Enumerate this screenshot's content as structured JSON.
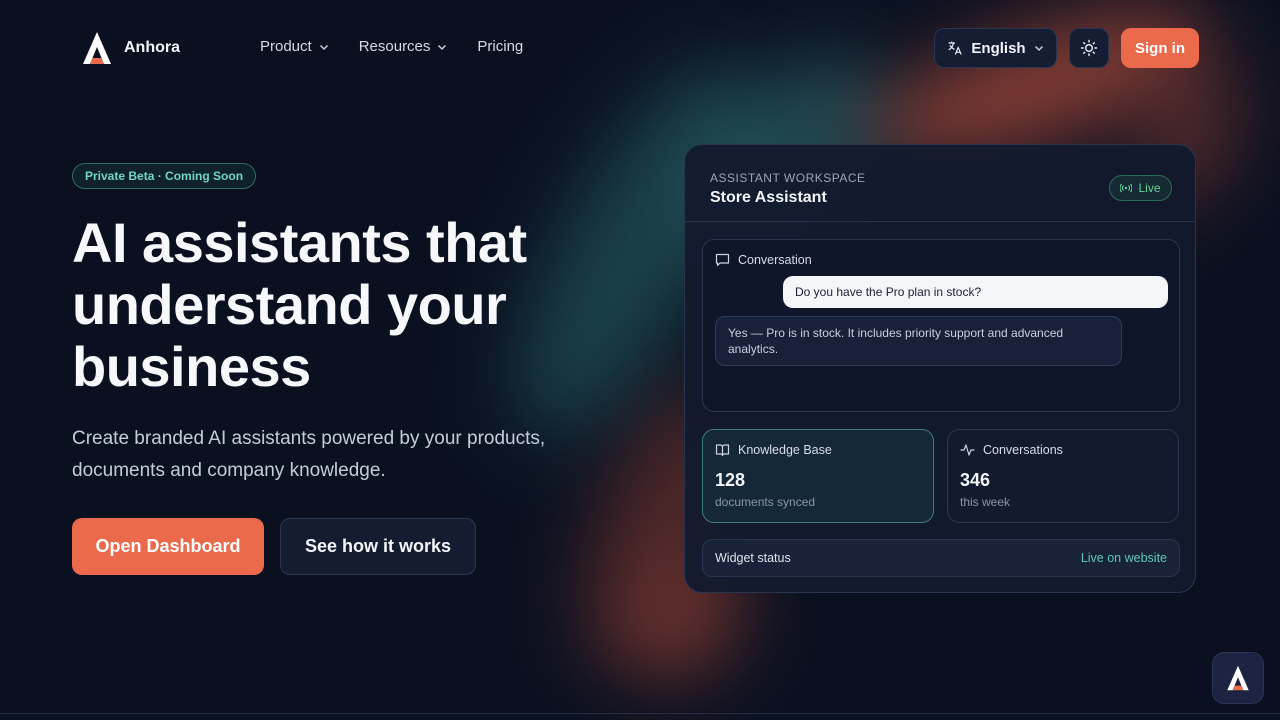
{
  "brand": {
    "name": "Anhora"
  },
  "nav": {
    "links": [
      {
        "label": "Product",
        "has_dropdown": true
      },
      {
        "label": "Resources",
        "has_dropdown": true
      },
      {
        "label": "Pricing",
        "has_dropdown": false
      }
    ],
    "language": "English",
    "sign_in": "Sign in"
  },
  "hero": {
    "badge": "Private Beta · Coming Soon",
    "title_lines": [
      "AI assistants that",
      "understand your",
      "business"
    ],
    "subtitle_lines": [
      "Create branded AI assistants powered by your products,",
      "documents and company knowledge."
    ],
    "primary_cta": "Open Dashboard",
    "secondary_cta": "See how it works"
  },
  "workspace": {
    "label": "ASSISTANT WORKSPACE",
    "title": "Store Assistant",
    "status": "Live",
    "conversation": {
      "label": "Conversation",
      "user_message": "Do you have the Pro plan in stock?",
      "bot_message_lines": [
        "Yes — Pro is in stock. It includes priority support and advanced",
        "analytics."
      ]
    },
    "stats": [
      {
        "label": "Knowledge Base",
        "value": "128",
        "caption": "documents synced",
        "icon": "book-icon"
      },
      {
        "label": "Conversations",
        "value": "346",
        "caption": "this week",
        "icon": "activity-icon"
      }
    ],
    "widget": {
      "label": "Widget status",
      "status": "Live on website"
    }
  },
  "colors": {
    "background": "#0a1020",
    "accent": "#ec6a4c",
    "teal": "#6fd6c4",
    "live_green": "#5fd39a"
  }
}
